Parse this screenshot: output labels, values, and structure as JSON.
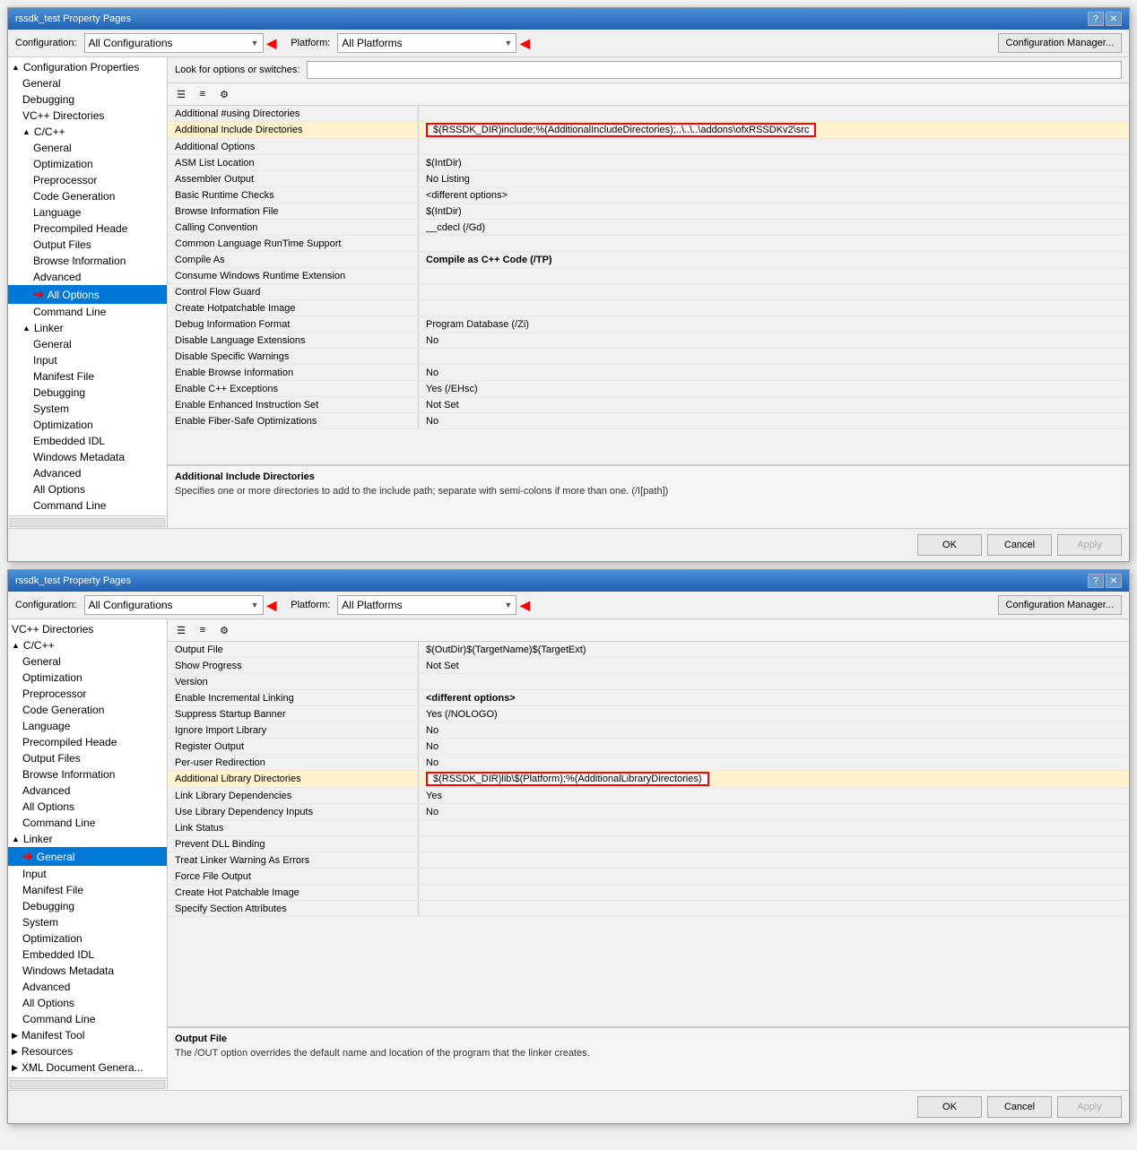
{
  "dialogs": [
    {
      "title": "rssdk_test Property Pages",
      "config_label": "Configuration:",
      "config_value": "All Configurations",
      "platform_label": "Platform:",
      "platform_value": "All Platforms",
      "config_manager_label": "Configuration Manager...",
      "look_for_label": "Look for options or switches:",
      "look_for_value": "",
      "ok_label": "OK",
      "cancel_label": "Cancel",
      "apply_label": "Apply",
      "sidebar_items": [
        {
          "label": "Configuration Properties",
          "indent": 0,
          "expand": "▲",
          "selected": false
        },
        {
          "label": "General",
          "indent": 1,
          "expand": "",
          "selected": false
        },
        {
          "label": "Debugging",
          "indent": 1,
          "expand": "",
          "selected": false
        },
        {
          "label": "VC++ Directories",
          "indent": 1,
          "expand": "",
          "selected": false
        },
        {
          "label": "C/C++",
          "indent": 1,
          "expand": "▲",
          "selected": false
        },
        {
          "label": "General",
          "indent": 2,
          "expand": "",
          "selected": false
        },
        {
          "label": "Optimization",
          "indent": 2,
          "expand": "",
          "selected": false
        },
        {
          "label": "Preprocessor",
          "indent": 2,
          "expand": "",
          "selected": false
        },
        {
          "label": "Code Generation",
          "indent": 2,
          "expand": "",
          "selected": false
        },
        {
          "label": "Language",
          "indent": 2,
          "expand": "",
          "selected": false
        },
        {
          "label": "Precompiled Heade",
          "indent": 2,
          "expand": "",
          "selected": false
        },
        {
          "label": "Output Files",
          "indent": 2,
          "expand": "",
          "selected": false
        },
        {
          "label": "Browse Information",
          "indent": 2,
          "expand": "",
          "selected": false
        },
        {
          "label": "Advanced",
          "indent": 2,
          "expand": "",
          "selected": false
        },
        {
          "label": "All Options",
          "indent": 2,
          "expand": "",
          "selected": true,
          "arrow": true
        },
        {
          "label": "Command Line",
          "indent": 2,
          "expand": "",
          "selected": false
        },
        {
          "label": "Linker",
          "indent": 1,
          "expand": "▲",
          "selected": false
        },
        {
          "label": "General",
          "indent": 2,
          "expand": "",
          "selected": false
        },
        {
          "label": "Input",
          "indent": 2,
          "expand": "",
          "selected": false
        },
        {
          "label": "Manifest File",
          "indent": 2,
          "expand": "",
          "selected": false
        },
        {
          "label": "Debugging",
          "indent": 2,
          "expand": "",
          "selected": false
        },
        {
          "label": "System",
          "indent": 2,
          "expand": "",
          "selected": false
        },
        {
          "label": "Optimization",
          "indent": 2,
          "expand": "",
          "selected": false
        },
        {
          "label": "Embedded IDL",
          "indent": 2,
          "expand": "",
          "selected": false
        },
        {
          "label": "Windows Metadata",
          "indent": 2,
          "expand": "",
          "selected": false
        },
        {
          "label": "Advanced",
          "indent": 2,
          "expand": "",
          "selected": false
        },
        {
          "label": "All Options",
          "indent": 2,
          "expand": "",
          "selected": false
        },
        {
          "label": "Command Line",
          "indent": 2,
          "expand": "",
          "selected": false
        }
      ],
      "prop_rows": [
        {
          "name": "Additional #using Directories",
          "value": "",
          "highlighted": false
        },
        {
          "name": "Additional Include Directories",
          "value": "$(RSSDK_DIR)include;%(AdditionalIncludeDirectories);..\\..\\..\\addons\\ofxRSSDKv2\\src",
          "highlighted": true
        },
        {
          "name": "Additional Options",
          "value": "",
          "highlighted": false
        },
        {
          "name": "ASM List Location",
          "value": "$(IntDir)",
          "highlighted": false
        },
        {
          "name": "Assembler Output",
          "value": "No Listing",
          "highlighted": false
        },
        {
          "name": "Basic Runtime Checks",
          "value": "<different options>",
          "highlighted": false
        },
        {
          "name": "Browse Information File",
          "value": "$(IntDir)",
          "highlighted": false
        },
        {
          "name": "Calling Convention",
          "value": "__cdecl (/Gd)",
          "highlighted": false
        },
        {
          "name": "Common Language RunTime Support",
          "value": "",
          "highlighted": false
        },
        {
          "name": "Compile As",
          "value": "Compile as C++ Code (/TP)",
          "highlighted": false,
          "bold": true
        },
        {
          "name": "Consume Windows Runtime Extension",
          "value": "",
          "highlighted": false
        },
        {
          "name": "Control Flow Guard",
          "value": "",
          "highlighted": false
        },
        {
          "name": "Create Hotpatchable Image",
          "value": "",
          "highlighted": false
        },
        {
          "name": "Debug Information Format",
          "value": "Program Database (/Zi)",
          "highlighted": false
        },
        {
          "name": "Disable Language Extensions",
          "value": "No",
          "highlighted": false
        },
        {
          "name": "Disable Specific Warnings",
          "value": "",
          "highlighted": false
        },
        {
          "name": "Enable Browse Information",
          "value": "No",
          "highlighted": false
        },
        {
          "name": "Enable C++ Exceptions",
          "value": "Yes (/EHsc)",
          "highlighted": false
        },
        {
          "name": "Enable Enhanced Instruction Set",
          "value": "Not Set",
          "highlighted": false
        },
        {
          "name": "Enable Fiber-Safe Optimizations",
          "value": "No",
          "highlighted": false
        }
      ],
      "info_title": "Additional Include Directories",
      "info_desc": "Specifies one or more directories to add to the include path; separate with semi-colons if more than one.   (/I[path])"
    },
    {
      "title": "rssdk_test Property Pages",
      "config_label": "Configuration:",
      "config_value": "All Configurations",
      "platform_label": "Platform:",
      "platform_value": "All Platforms",
      "config_manager_label": "Configuration Manager...",
      "look_for_label": "",
      "look_for_value": "",
      "ok_label": "OK",
      "cancel_label": "Cancel",
      "apply_label": "Apply",
      "sidebar_items": [
        {
          "label": "VC++ Directories",
          "indent": 0,
          "expand": "",
          "selected": false
        },
        {
          "label": "C/C++",
          "indent": 0,
          "expand": "▲",
          "selected": false
        },
        {
          "label": "General",
          "indent": 1,
          "expand": "",
          "selected": false
        },
        {
          "label": "Optimization",
          "indent": 1,
          "expand": "",
          "selected": false
        },
        {
          "label": "Preprocessor",
          "indent": 1,
          "expand": "",
          "selected": false
        },
        {
          "label": "Code Generation",
          "indent": 1,
          "expand": "",
          "selected": false
        },
        {
          "label": "Language",
          "indent": 1,
          "expand": "",
          "selected": false
        },
        {
          "label": "Precompiled Heade",
          "indent": 1,
          "expand": "",
          "selected": false
        },
        {
          "label": "Output Files",
          "indent": 1,
          "expand": "",
          "selected": false
        },
        {
          "label": "Browse Information",
          "indent": 1,
          "expand": "",
          "selected": false
        },
        {
          "label": "Advanced",
          "indent": 1,
          "expand": "",
          "selected": false
        },
        {
          "label": "All Options",
          "indent": 1,
          "expand": "",
          "selected": false
        },
        {
          "label": "Command Line",
          "indent": 1,
          "expand": "",
          "selected": false
        },
        {
          "label": "Linker",
          "indent": 0,
          "expand": "▲",
          "selected": false
        },
        {
          "label": "General",
          "indent": 1,
          "expand": "",
          "selected": true,
          "arrow": true
        },
        {
          "label": "Input",
          "indent": 1,
          "expand": "",
          "selected": false
        },
        {
          "label": "Manifest File",
          "indent": 1,
          "expand": "",
          "selected": false
        },
        {
          "label": "Debugging",
          "indent": 1,
          "expand": "",
          "selected": false
        },
        {
          "label": "System",
          "indent": 1,
          "expand": "",
          "selected": false
        },
        {
          "label": "Optimization",
          "indent": 1,
          "expand": "",
          "selected": false
        },
        {
          "label": "Embedded IDL",
          "indent": 1,
          "expand": "",
          "selected": false
        },
        {
          "label": "Windows Metadata",
          "indent": 1,
          "expand": "",
          "selected": false
        },
        {
          "label": "Advanced",
          "indent": 1,
          "expand": "",
          "selected": false
        },
        {
          "label": "All Options",
          "indent": 1,
          "expand": "",
          "selected": false
        },
        {
          "label": "Command Line",
          "indent": 1,
          "expand": "",
          "selected": false
        },
        {
          "label": "Manifest Tool",
          "indent": 0,
          "expand": "▶",
          "selected": false
        },
        {
          "label": "Resources",
          "indent": 0,
          "expand": "▶",
          "selected": false
        },
        {
          "label": "XML Document Genera...",
          "indent": 0,
          "expand": "▶",
          "selected": false
        }
      ],
      "prop_rows": [
        {
          "name": "Output File",
          "value": "$(OutDir)$(TargetName)$(TargetExt)",
          "highlighted": false
        },
        {
          "name": "Show Progress",
          "value": "Not Set",
          "highlighted": false
        },
        {
          "name": "Version",
          "value": "",
          "highlighted": false
        },
        {
          "name": "Enable Incremental Linking",
          "value": "<different options>",
          "highlighted": false,
          "bold": true
        },
        {
          "name": "Suppress Startup Banner",
          "value": "Yes (/NOLOGO)",
          "highlighted": false
        },
        {
          "name": "Ignore Import Library",
          "value": "No",
          "highlighted": false
        },
        {
          "name": "Register Output",
          "value": "No",
          "highlighted": false
        },
        {
          "name": "Per-user Redirection",
          "value": "No",
          "highlighted": false
        },
        {
          "name": "Additional Library Directories",
          "value": "$(RSSDK_DIR)lib\\$(Platform);%(AdditionalLibraryDirectories)",
          "highlighted": true
        },
        {
          "name": "Link Library Dependencies",
          "value": "Yes",
          "highlighted": false
        },
        {
          "name": "Use Library Dependency Inputs",
          "value": "No",
          "highlighted": false
        },
        {
          "name": "Link Status",
          "value": "",
          "highlighted": false
        },
        {
          "name": "Prevent DLL Binding",
          "value": "",
          "highlighted": false
        },
        {
          "name": "Treat Linker Warning As Errors",
          "value": "",
          "highlighted": false
        },
        {
          "name": "Force File Output",
          "value": "",
          "highlighted": false
        },
        {
          "name": "Create Hot Patchable Image",
          "value": "",
          "highlighted": false
        },
        {
          "name": "Specify Section Attributes",
          "value": "",
          "highlighted": false
        }
      ],
      "info_title": "Output File",
      "info_desc": "The /OUT option overrides the default name and location of the program that the linker creates."
    }
  ]
}
